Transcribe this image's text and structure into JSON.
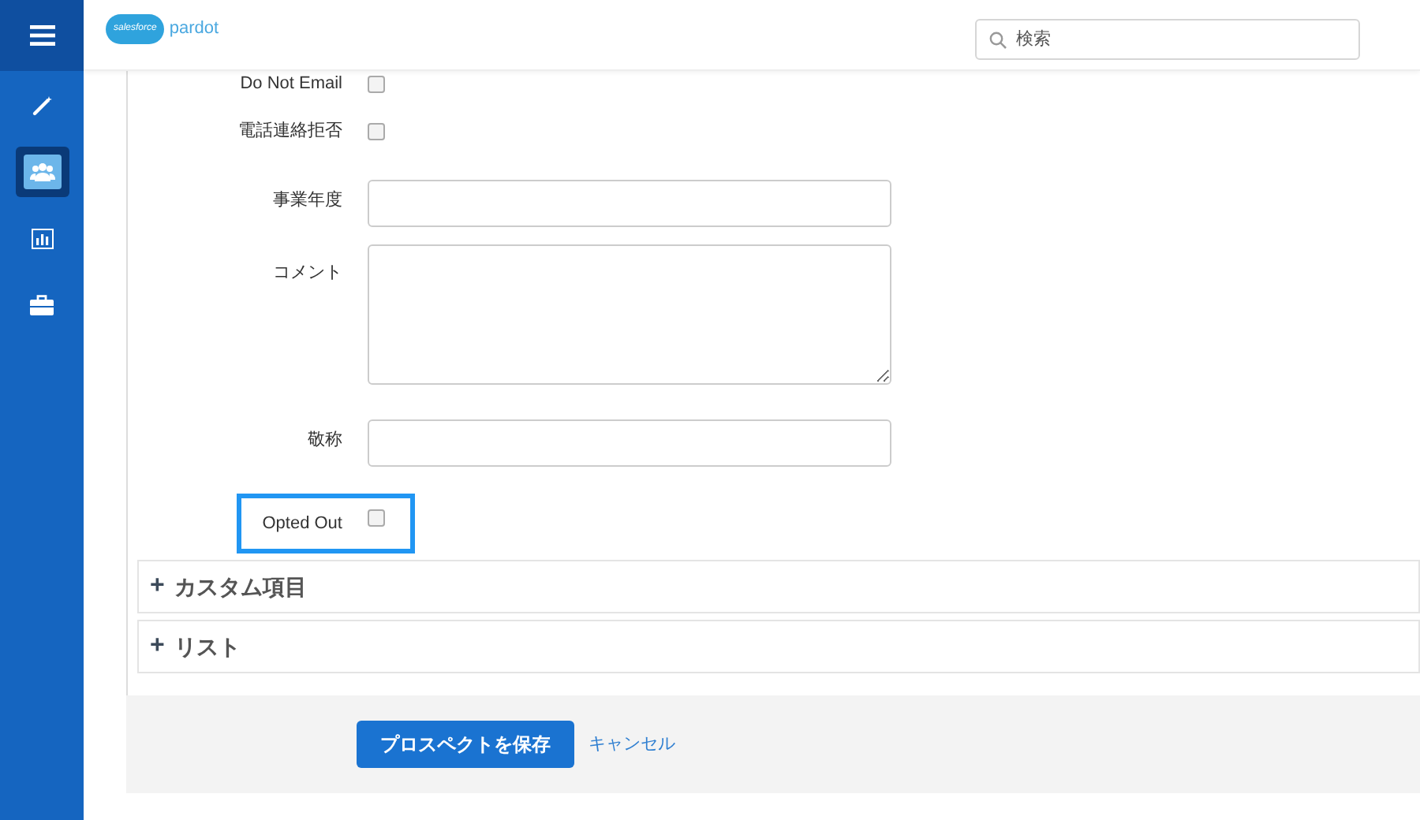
{
  "sidebar": {
    "items": [
      {
        "kind": "wand",
        "selected": false
      },
      {
        "kind": "people",
        "selected": true
      },
      {
        "kind": "chart",
        "selected": false
      },
      {
        "kind": "briefcase",
        "selected": false
      }
    ]
  },
  "header": {
    "logo_cloud": "salesforce",
    "logo_text": "pardot",
    "search": {
      "placeholder": "検索"
    }
  },
  "form": {
    "fields": [
      {
        "kind": "checkbox",
        "label": "Do Not Email",
        "checked": false,
        "highlighted": false
      },
      {
        "kind": "checkbox",
        "label": "電話連絡拒否",
        "checked": false,
        "highlighted": false
      },
      {
        "kind": "text",
        "label": "事業年度",
        "highlighted": false
      },
      {
        "kind": "textarea",
        "label": "コメント",
        "highlighted": false
      },
      {
        "kind": "text",
        "label": "敬称",
        "highlighted": false
      },
      {
        "kind": "checkbox",
        "label": "Opted Out",
        "checked": false,
        "highlighted": true
      }
    ]
  },
  "sections": [
    {
      "icon": "+",
      "title": "カスタム項目"
    },
    {
      "icon": "+",
      "title": "リスト"
    }
  ],
  "footer": {
    "save": "プロスペクトを保存",
    "cancel": "キャンセル"
  }
}
